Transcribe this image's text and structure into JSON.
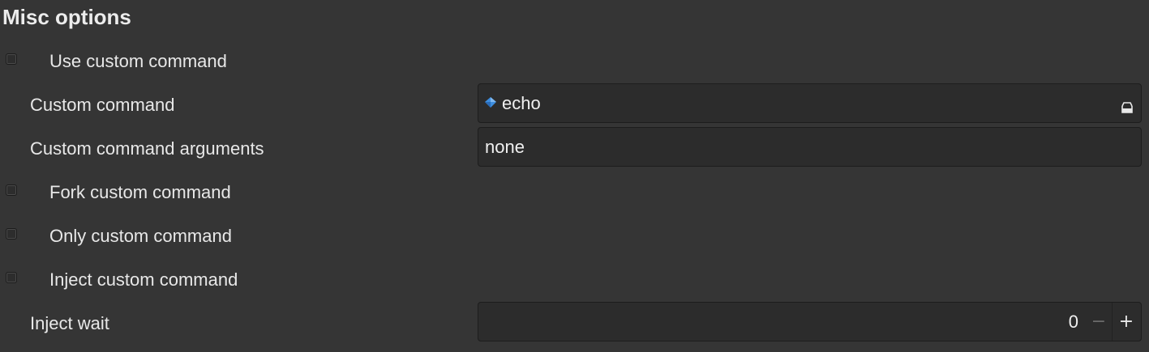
{
  "section": {
    "title": "Misc options"
  },
  "options": {
    "use_custom_command": {
      "label": "Use custom command",
      "checked": false
    },
    "custom_command": {
      "label": "Custom command",
      "value": "echo",
      "icon": "app-icon"
    },
    "custom_command_arguments": {
      "label": "Custom command arguments",
      "value": "none"
    },
    "fork_custom_command": {
      "label": "Fork custom command",
      "checked": false
    },
    "only_custom_command": {
      "label": "Only custom command",
      "checked": false
    },
    "inject_custom_command": {
      "label": "Inject custom command",
      "checked": false
    },
    "inject_wait": {
      "label": "Inject wait",
      "value": "0",
      "minus": "−",
      "plus": "+"
    }
  },
  "colors": {
    "background": "#353535",
    "entry_background": "#2c2c2c",
    "text": "#e8e8e8",
    "app_icon_blue": "#3d8ee0"
  }
}
